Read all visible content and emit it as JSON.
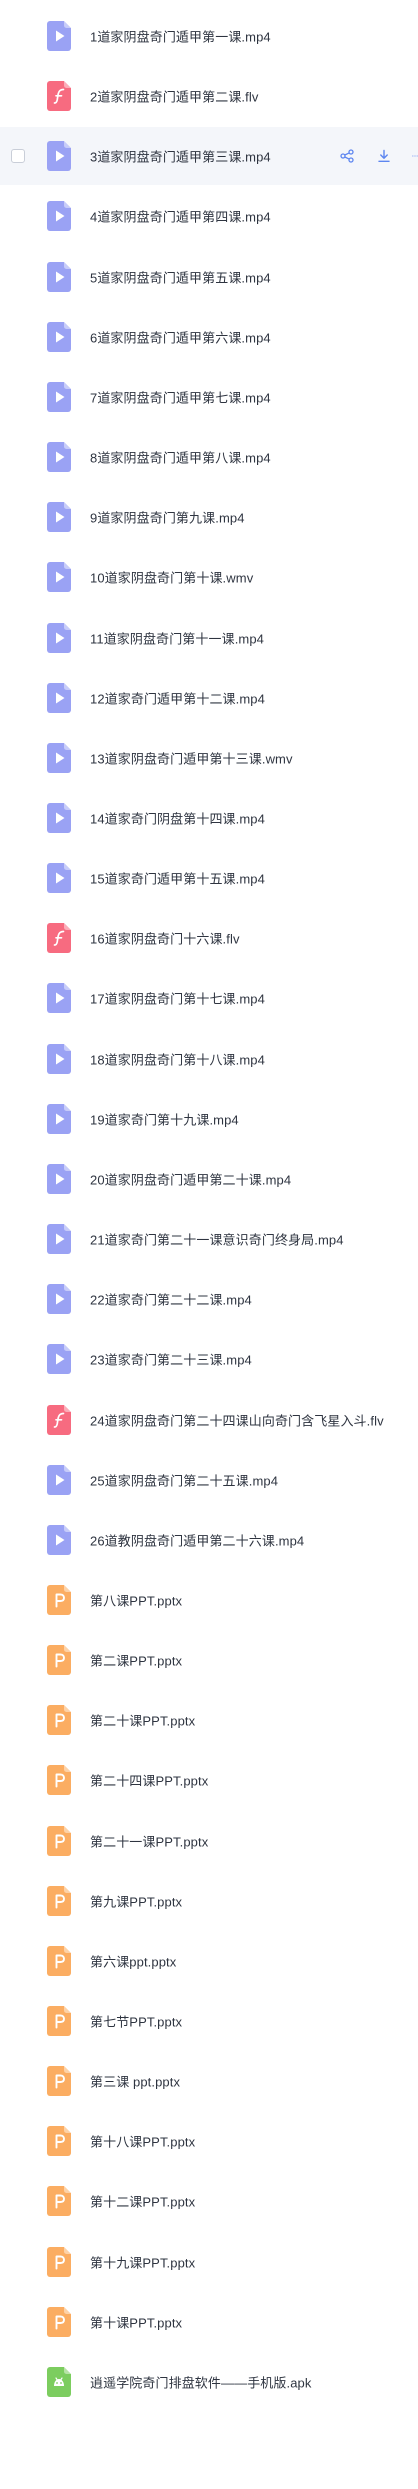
{
  "colors": {
    "video": "#9aa2f4",
    "flash": "#f76b80",
    "ppt": "#fbad62",
    "apk": "#7ccd5f",
    "action": "#5d86f0",
    "hover_row": "#f4f6fa"
  },
  "hovered_row": 2,
  "files": [
    {
      "name": "1道家阴盘奇门遁甲第一课.mp4",
      "icon": "video-file-icon"
    },
    {
      "name": "2道家阴盘奇门遁甲第二课.flv",
      "icon": "flash-file-icon"
    },
    {
      "name": "3道家阴盘奇门遁甲第三课.mp4",
      "icon": "video-file-icon"
    },
    {
      "name": "4道家阴盘奇门遁甲第四课.mp4",
      "icon": "video-file-icon"
    },
    {
      "name": "5道家阴盘奇门遁甲第五课.mp4",
      "icon": "video-file-icon"
    },
    {
      "name": "6道家阴盘奇门遁甲第六课.mp4",
      "icon": "video-file-icon"
    },
    {
      "name": "7道家阴盘奇门遁甲第七课.mp4",
      "icon": "video-file-icon"
    },
    {
      "name": "8道家阴盘奇门遁甲第八课.mp4",
      "icon": "video-file-icon"
    },
    {
      "name": "9道家阴盘奇门第九课.mp4",
      "icon": "video-file-icon"
    },
    {
      "name": "10道家阴盘奇门第十课.wmv",
      "icon": "video-file-icon"
    },
    {
      "name": "11道家阴盘奇门第十一课.mp4",
      "icon": "video-file-icon"
    },
    {
      "name": "12道家奇门遁甲第十二课.mp4",
      "icon": "video-file-icon"
    },
    {
      "name": "13道家阴盘奇门遁甲第十三课.wmv",
      "icon": "video-file-icon"
    },
    {
      "name": "14道家奇门阴盘第十四课.mp4",
      "icon": "video-file-icon"
    },
    {
      "name": "15道家奇门遁甲第十五课.mp4",
      "icon": "video-file-icon"
    },
    {
      "name": "16道家阴盘奇门十六课.flv",
      "icon": "flash-file-icon"
    },
    {
      "name": "17道家阴盘奇门第十七课.mp4",
      "icon": "video-file-icon"
    },
    {
      "name": "18道家阴盘奇门第十八课.mp4",
      "icon": "video-file-icon"
    },
    {
      "name": "19道家奇门第十九课.mp4",
      "icon": "video-file-icon"
    },
    {
      "name": "20道家阴盘奇门遁甲第二十课.mp4",
      "icon": "video-file-icon"
    },
    {
      "name": "21道家奇门第二十一课意识奇门终身局.mp4",
      "icon": "video-file-icon"
    },
    {
      "name": "22道家奇门第二十二课.mp4",
      "icon": "video-file-icon"
    },
    {
      "name": "23道家奇门第二十三课.mp4",
      "icon": "video-file-icon"
    },
    {
      "name": "24道家阴盘奇门第二十四课山向奇门含飞星入斗.flv",
      "icon": "flash-file-icon"
    },
    {
      "name": "25道家阴盘奇门第二十五课.mp4",
      "icon": "video-file-icon"
    },
    {
      "name": "26道教阴盘奇门遁甲第二十六课.mp4",
      "icon": "video-file-icon"
    },
    {
      "name": "第八课PPT.pptx",
      "icon": "ppt-file-icon"
    },
    {
      "name": "第二课PPT.pptx",
      "icon": "ppt-file-icon"
    },
    {
      "name": "第二十课PPT.pptx",
      "icon": "ppt-file-icon"
    },
    {
      "name": "第二十四课PPT.pptx",
      "icon": "ppt-file-icon"
    },
    {
      "name": "第二十一课PPT.pptx",
      "icon": "ppt-file-icon"
    },
    {
      "name": "第九课PPT.pptx",
      "icon": "ppt-file-icon"
    },
    {
      "name": "第六课ppt.pptx",
      "icon": "ppt-file-icon"
    },
    {
      "name": "第七节PPT.pptx",
      "icon": "ppt-file-icon"
    },
    {
      "name": "第三课 ppt.pptx",
      "icon": "ppt-file-icon"
    },
    {
      "name": "第十八课PPT.pptx",
      "icon": "ppt-file-icon"
    },
    {
      "name": "第十二课PPT.pptx",
      "icon": "ppt-file-icon"
    },
    {
      "name": "第十九课PPT.pptx",
      "icon": "ppt-file-icon"
    },
    {
      "name": "第十课PPT.pptx",
      "icon": "ppt-file-icon"
    },
    {
      "name": "逍遥学院奇门排盘软件——手机版.apk",
      "icon": "apk-file-icon"
    }
  ]
}
